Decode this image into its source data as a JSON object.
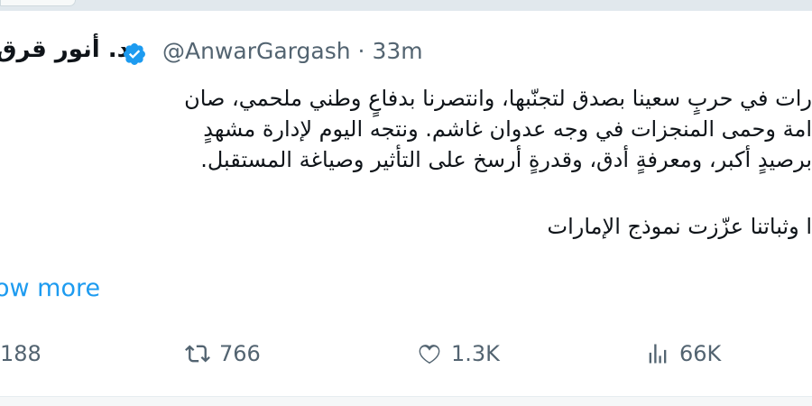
{
  "tweet": {
    "display_name": "د. أنور قرق",
    "handle": "@AnwarGargash",
    "separator": "·",
    "time": "33m",
    "lines": [
      "رات في حربٍ سعينا بصدق لتجنّبها، وانتصرنا بدفاعٍ وطني ملحمي، صان",
      "امة وحمى المنجزات في وجه عدوان غاشم. ونتجه اليوم لإدارة مشهدٍ",
      "برصيدٍ أكبر، ومعرفةٍ أدق، وقدرةٍ أرسخ على التأثير وصياغة المستقبل.",
      "ا وثباتنا عزّزت نموذج الإمارات"
    ],
    "show_more": "ow more"
  },
  "actions": {
    "replies": "188",
    "reposts": "766",
    "likes": "1.3K",
    "views": "66K"
  },
  "colors": {
    "accent": "#1d9bf0",
    "muted": "#536471",
    "text": "#0f1419"
  },
  "icons": [
    "verified-badge-icon",
    "reply-icon",
    "retweet-icon",
    "heart-icon",
    "views-icon"
  ]
}
